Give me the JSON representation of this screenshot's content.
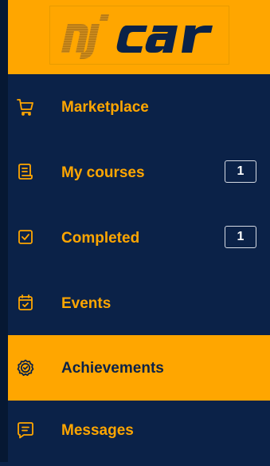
{
  "brand": {
    "logo_text": "nj car",
    "colors": {
      "accent": "#ffa600",
      "background": "#0b2248"
    }
  },
  "nav": {
    "items": [
      {
        "label": "Marketplace",
        "icon": "shopping-cart-icon",
        "badge": null,
        "active": false
      },
      {
        "label": "My courses",
        "icon": "document-icon",
        "badge": "1",
        "active": false
      },
      {
        "label": "Completed",
        "icon": "checkbox-icon",
        "badge": "1",
        "active": false
      },
      {
        "label": "Events",
        "icon": "calendar-check-icon",
        "badge": null,
        "active": false
      },
      {
        "label": "Achievements",
        "icon": "badge-check-icon",
        "badge": null,
        "active": true
      },
      {
        "label": "Messages",
        "icon": "message-icon",
        "badge": null,
        "active": false
      }
    ]
  }
}
